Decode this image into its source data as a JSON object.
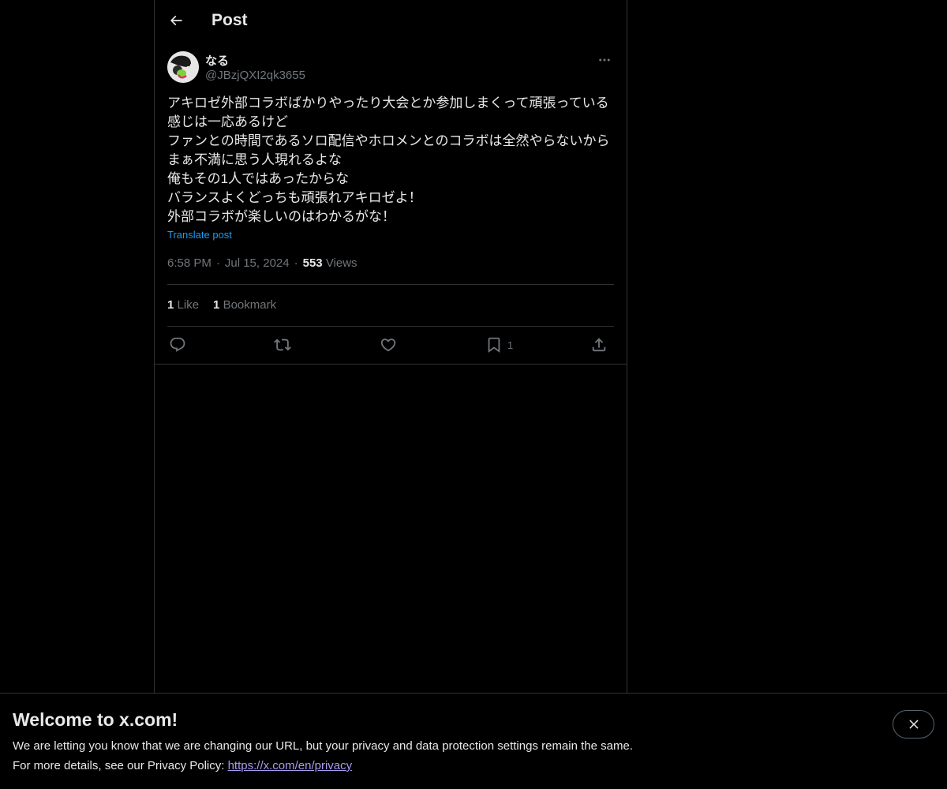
{
  "header": {
    "title": "Post"
  },
  "post": {
    "author": {
      "display_name": "なる",
      "handle": "@JBzjQXI2qk3655"
    },
    "text_lines": [
      "アキロゼ外部コラボばかりやったり大会とか参加しまくって頑張っている",
      "感じは一応あるけど",
      "ファンとの時間であるソロ配信やホロメンとのコラボは全然やらないから",
      "まぁ不満に思う人現れるよな",
      "俺もその1人ではあったからな",
      "バランスよくどっちも頑張れアキロゼよ！",
      "外部コラボが楽しいのはわかるがな！"
    ],
    "translate_label": "Translate post",
    "time": "6:58 PM",
    "date": "Jul 15, 2024",
    "separator": "·",
    "views_count": "553",
    "views_label": "Views",
    "likes_count": "1",
    "likes_label": "Like",
    "bookmarks_count": "1",
    "bookmarks_label": "Bookmark",
    "action_bookmark_count": "1"
  },
  "banner": {
    "title": "Welcome to x.com!",
    "line1": "We are letting you know that we are changing our URL, but your privacy and data protection settings remain the same.",
    "line2_prefix": "For more details, see our Privacy Policy: ",
    "link": "https://x.com/en/privacy"
  },
  "colors": {
    "background": "#000000",
    "text_primary": "#e7e9ea",
    "text_secondary": "#71767b",
    "accent": "#1d9bf0",
    "border": "#2f3336",
    "link": "#a89cf0"
  },
  "icons": {
    "back": "arrow-left-icon",
    "more": "more-horizontal-icon",
    "reply": "reply-icon",
    "repost": "repost-icon",
    "like": "heart-icon",
    "bookmark": "bookmark-icon",
    "share": "share-icon",
    "close": "close-icon"
  }
}
